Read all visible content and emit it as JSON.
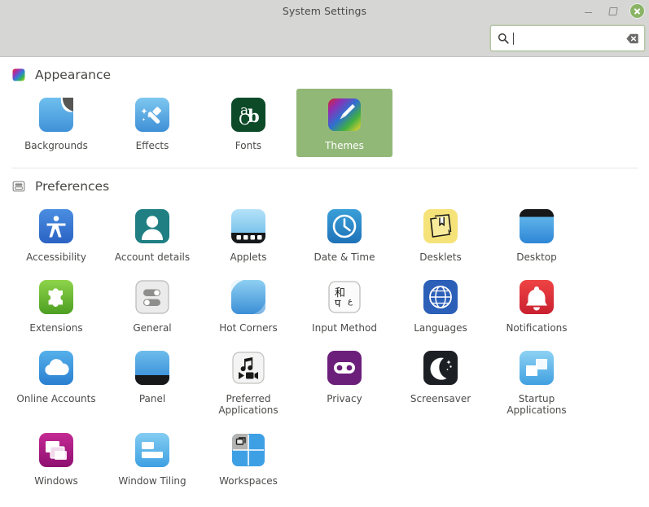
{
  "window": {
    "title": "System Settings",
    "controls": {
      "minimize": "minimize",
      "maximize": "maximize",
      "close": "close"
    }
  },
  "search": {
    "value": "",
    "placeholder": "",
    "icon": "search-icon",
    "clear_icon": "clear-icon"
  },
  "colors": {
    "header_bg": "#d6d6d4",
    "selection": "#92b878",
    "close_button": "#8ab465",
    "search_border": "#b4c4a6",
    "text": "#4b4b49"
  },
  "sections": [
    {
      "id": "appearance",
      "title": "Appearance",
      "icon": "appearance-gradient-icon",
      "items": [
        {
          "label": "Backgrounds",
          "icon": "backgrounds-icon",
          "selected": false
        },
        {
          "label": "Effects",
          "icon": "effects-icon",
          "selected": false
        },
        {
          "label": "Fonts",
          "icon": "fonts-icon",
          "selected": false
        },
        {
          "label": "Themes",
          "icon": "themes-icon",
          "selected": true
        }
      ]
    },
    {
      "id": "preferences",
      "title": "Preferences",
      "icon": "preferences-icon",
      "items": [
        {
          "label": "Accessibility",
          "icon": "accessibility-icon",
          "selected": false
        },
        {
          "label": "Account details",
          "icon": "account-details-icon",
          "selected": false
        },
        {
          "label": "Applets",
          "icon": "applets-icon",
          "selected": false
        },
        {
          "label": "Date & Time",
          "icon": "date-time-icon",
          "selected": false
        },
        {
          "label": "Desklets",
          "icon": "desklets-icon",
          "selected": false
        },
        {
          "label": "Desktop",
          "icon": "desktop-icon",
          "selected": false
        },
        {
          "label": "Extensions",
          "icon": "extensions-icon",
          "selected": false
        },
        {
          "label": "General",
          "icon": "general-icon",
          "selected": false
        },
        {
          "label": "Hot Corners",
          "icon": "hot-corners-icon",
          "selected": false
        },
        {
          "label": "Input Method",
          "icon": "input-method-icon",
          "selected": false
        },
        {
          "label": "Languages",
          "icon": "languages-icon",
          "selected": false
        },
        {
          "label": "Notifications",
          "icon": "notifications-icon",
          "selected": false
        },
        {
          "label": "Online Accounts",
          "icon": "online-accounts-icon",
          "selected": false
        },
        {
          "label": "Panel",
          "icon": "panel-icon",
          "selected": false
        },
        {
          "label": "Preferred Applications",
          "icon": "preferred-applications-icon",
          "selected": false
        },
        {
          "label": "Privacy",
          "icon": "privacy-icon",
          "selected": false
        },
        {
          "label": "Screensaver",
          "icon": "screensaver-icon",
          "selected": false
        },
        {
          "label": "Startup Applications",
          "icon": "startup-applications-icon",
          "selected": false
        },
        {
          "label": "Windows",
          "icon": "windows-icon",
          "selected": false
        },
        {
          "label": "Window Tiling",
          "icon": "window-tiling-icon",
          "selected": false
        },
        {
          "label": "Workspaces",
          "icon": "workspaces-icon",
          "selected": false
        }
      ]
    }
  ]
}
